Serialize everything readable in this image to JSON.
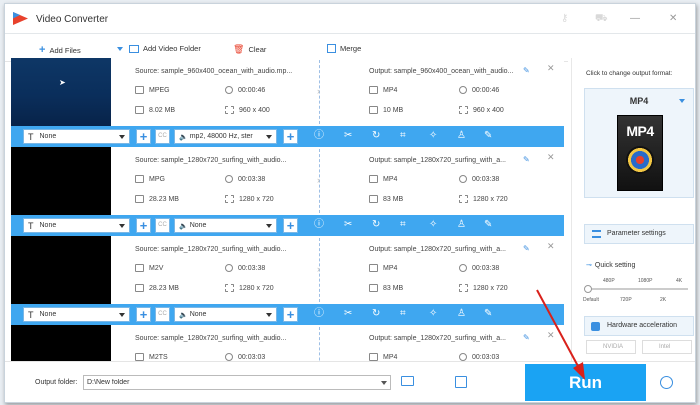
{
  "app": {
    "title": "Video Converter"
  },
  "toolbar": {
    "add_files": "Add Files",
    "add_video_folder": "Add Video Folder",
    "clear": "Clear",
    "merge": "Merge"
  },
  "items": [
    {
      "source": "Source: sample_960x400_ocean_with_audio.mp...",
      "src_format": "MPEG",
      "src_duration": "00:00:46",
      "src_size": "8.02 MB",
      "src_res": "960 x 400",
      "output": "Output: sample_960x400_ocean_with_audio...",
      "out_format": "MP4",
      "out_duration": "00:00:46",
      "out_size": "10 MB",
      "out_res": "960 x 400",
      "subtitle": "None",
      "audio": "mp2, 48000 Hz, ster",
      "thumb": "ocean"
    },
    {
      "source": "Source: sample_1280x720_surfing_with_audio...",
      "src_format": "MPG",
      "src_duration": "00:03:38",
      "src_size": "28.23 MB",
      "src_res": "1280 x 720",
      "output": "Output: sample_1280x720_surfing_with_a...",
      "out_format": "MP4",
      "out_duration": "00:03:38",
      "out_size": "83 MB",
      "out_res": "1280 x 720",
      "subtitle": "None",
      "audio": "None",
      "thumb": "black"
    },
    {
      "source": "Source: sample_1280x720_surfing_with_audio...",
      "src_format": "M2V",
      "src_duration": "00:03:38",
      "src_size": "28.23 MB",
      "src_res": "1280 x 720",
      "output": "Output: sample_1280x720_surfing_with_a...",
      "out_format": "MP4",
      "out_duration": "00:03:38",
      "out_size": "83 MB",
      "out_res": "1280 x 720",
      "subtitle": "None",
      "audio": "None",
      "thumb": "black"
    },
    {
      "source": "Source: sample_1280x720_surfing_with_audio...",
      "src_format": "M2TS",
      "src_duration": "00:03:03",
      "output": "Output: sample_1280x720_surfing_with_a...",
      "out_format": "MP4",
      "out_duration": "00:03:03",
      "thumb": "black"
    }
  ],
  "cc_label": "CC",
  "right_panel": {
    "click_to_change": "Click to change output format:",
    "format": "MP4",
    "format_image_label": "MP4",
    "parameter_settings": "Parameter settings",
    "quick_setting": "Quick setting",
    "ticks_top": [
      "480P",
      "1080P",
      "4K"
    ],
    "ticks_bottom": [
      "Default",
      "720P",
      "2K"
    ],
    "quick_level_percent": 0,
    "hardware_acceleration": "Hardware acceleration",
    "gpu_nvidia": "NVIDIA",
    "gpu_intel": "Intel"
  },
  "bottom": {
    "output_folder_label": "Output folder:",
    "output_folder_value": "D:\\New folder",
    "run": "Run"
  },
  "colors": {
    "accent": "#3fa7f0",
    "run": "#1aa3f3",
    "arrow": "#d9211b"
  }
}
